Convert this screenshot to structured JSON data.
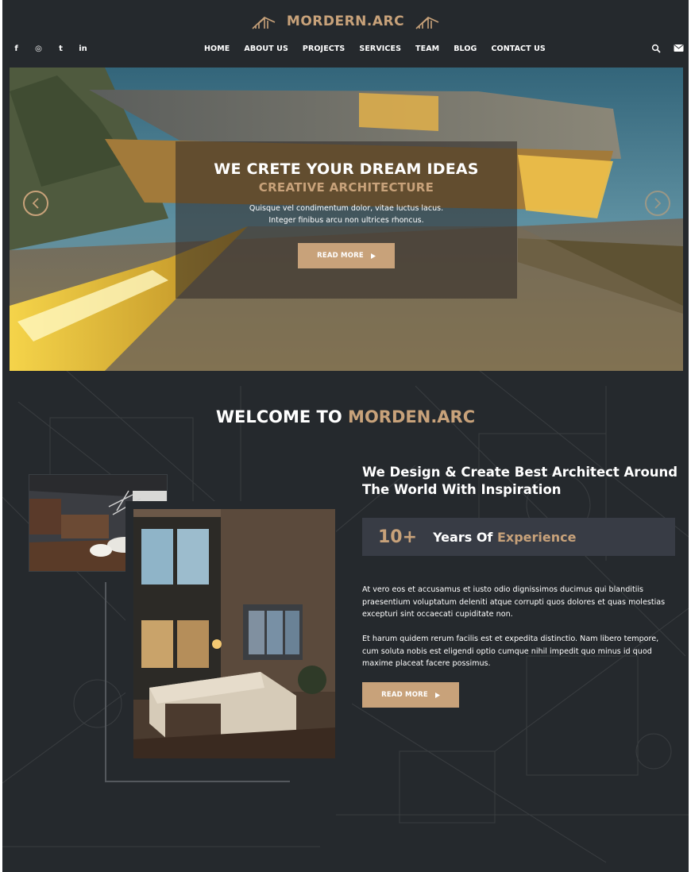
{
  "brand": {
    "name": "MORDERN.ARC"
  },
  "social": [
    {
      "name": "facebook",
      "glyph": "f"
    },
    {
      "name": "instagram",
      "glyph": "◎"
    },
    {
      "name": "twitter",
      "glyph": "t"
    },
    {
      "name": "linkedin",
      "glyph": "in"
    }
  ],
  "nav": {
    "items": [
      "HOME",
      "ABOUT US",
      "PROJECTS",
      "SERVICES",
      "TEAM",
      "BLOG",
      "CONTACT US"
    ]
  },
  "hero": {
    "title": "WE CRETE YOUR DREAM IDEAS",
    "subtitle": "CREATIVE ARCHITECTURE",
    "line1": "Quisque vel condimentum dolor, vitae luctus lacus.",
    "line2": "Integer finibus arcu non ultrices rhoncus.",
    "button": "READ MORE"
  },
  "welcome": {
    "prefix": "WELCOME TO ",
    "accent": "MORDEN.ARC"
  },
  "about": {
    "title": "We Design & Create Best Architect Around The World With Inspiration",
    "experience_number": "10+",
    "experience_label": "Years Of ",
    "experience_accent": "Experience",
    "paragraph1": "At vero eos et accusamus et iusto odio dignissimos ducimus qui blanditiis praesentium voluptatum deleniti atque corrupti quos dolores et quas molestias excepturi sint occaecati cupiditate non.",
    "paragraph2": "Et harum quidem rerum facilis est et expedita distinctio. Nam libero tempore, cum soluta nobis est eligendi optio cumque nihil impedit quo minus id quod maxime placeat facere possimus.",
    "button": "READ MORE"
  },
  "colors": {
    "accent": "#c8a27a",
    "background": "#25292d",
    "panel": "#383c45"
  },
  "icons": [
    "house-logo-icon",
    "search-icon",
    "mail-icon",
    "chevron-left-icon",
    "chevron-right-icon",
    "play-arrow-icon"
  ]
}
